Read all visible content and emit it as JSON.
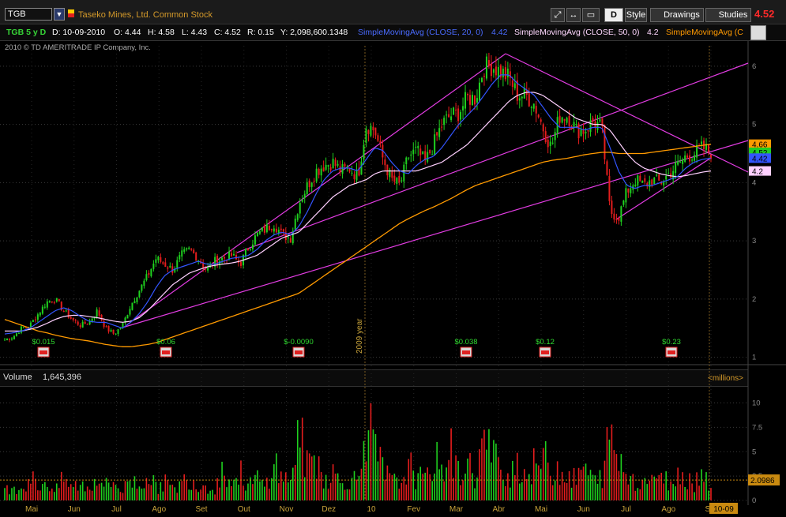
{
  "toolbar": {
    "symbol": "TGB",
    "company": "Taseko Mines, Ltd. Common Stock",
    "period_button": "D",
    "style_label": "Style",
    "drawings_label": "Drawings",
    "studies_label": "Studies",
    "last_price": "4.52"
  },
  "infobar": {
    "chart_id": "TGB 5 y D",
    "date": "D: 10-09-2010",
    "open": "O: 4.44",
    "high": "H: 4.58",
    "low": "L: 4.43",
    "close": "C: 4.52",
    "range": "R: 0.15",
    "volume_total": "Y: 2,098,600.1348",
    "sma20_label": "SimpleMovingAvg (CLOSE, 20, 0)",
    "sma20_value": "4.42",
    "sma50_label": "SimpleMovingAvg (CLOSE, 50, 0)",
    "sma50_value": "4.2",
    "sma200_label": "SimpleMovingAvg (C"
  },
  "copyright": "2010 © TD AMERITRADE IP Company, Inc.",
  "volume_panel": {
    "label": "Volume",
    "value": "1,645,396",
    "units": "<millions>",
    "current_level": "2.0986"
  },
  "chart_data": {
    "type": "candlestick",
    "price_axis": {
      "ticks": [
        1,
        2,
        3,
        4,
        5,
        6
      ],
      "ylim": [
        0.9,
        6.35
      ]
    },
    "volume_axis": {
      "ticks": [
        0,
        2.5,
        5,
        7.5,
        10
      ],
      "ylim": [
        0,
        11.5
      ]
    },
    "months": [
      "Mai",
      "Jun",
      "Jul",
      "Ago",
      "Set",
      "Out",
      "Nov",
      "Dez",
      "10",
      "Fev",
      "Mar",
      "Abr",
      "Mai",
      "Jun",
      "Jul",
      "Ago",
      "Set"
    ],
    "year_marker": "2009 year",
    "date_marker": "10-09",
    "price_tags": [
      {
        "label": "4.66",
        "value": 4.66,
        "color": "#ff9a00"
      },
      {
        "label": "4.52",
        "value": 4.52,
        "color": "#22cc22"
      },
      {
        "label": "4.42",
        "value": 4.42,
        "color": "#3355ff"
      },
      {
        "label": "4.2",
        "value": 4.2,
        "color": "#ffd0ff"
      }
    ],
    "dividends": [
      "$0.015",
      "$0.06",
      "$-0.0090",
      "$0.038",
      "$0.12",
      "$0.23"
    ],
    "close_series": [
      1.3,
      1.35,
      1.5,
      1.55,
      1.75,
      1.95,
      2.0,
      1.8,
      1.65,
      1.55,
      1.6,
      1.8,
      1.5,
      1.4,
      1.55,
      1.9,
      2.15,
      2.4,
      2.7,
      2.6,
      2.5,
      2.75,
      2.85,
      2.7,
      2.5,
      2.65,
      2.7,
      2.75,
      2.6,
      2.9,
      3.1,
      3.2,
      3.3,
      3.1,
      3.05,
      3.65,
      3.95,
      4.2,
      4.3,
      4.35,
      4.2,
      4.25,
      4.1,
      5.0,
      4.9,
      4.4,
      4.05,
      3.95,
      4.45,
      4.55,
      4.35,
      4.65,
      5.0,
      5.15,
      5.2,
      5.45,
      5.45,
      6.0,
      6.0,
      5.9,
      5.8,
      5.5,
      5.5,
      5.35,
      4.95,
      4.6,
      5.15,
      5.15,
      4.9,
      4.9,
      5.05,
      4.95,
      3.5,
      3.4,
      3.85,
      4.05,
      3.95,
      4.05,
      4.0,
      4.15,
      4.3,
      4.45,
      4.5,
      4.6,
      4.52
    ],
    "sma20_series": [
      1.4,
      1.42,
      1.45,
      1.5,
      1.6,
      1.7,
      1.8,
      1.85,
      1.8,
      1.7,
      1.62,
      1.6,
      1.6,
      1.55,
      1.5,
      1.6,
      1.75,
      1.95,
      2.2,
      2.4,
      2.5,
      2.55,
      2.6,
      2.65,
      2.6,
      2.6,
      2.65,
      2.7,
      2.72,
      2.75,
      2.85,
      3.0,
      3.1,
      3.15,
      3.1,
      3.25,
      3.5,
      3.8,
      4.05,
      4.2,
      4.25,
      4.25,
      4.2,
      4.4,
      4.6,
      4.55,
      4.35,
      4.2,
      4.15,
      4.3,
      4.4,
      4.45,
      4.6,
      4.8,
      5.0,
      5.15,
      5.3,
      5.5,
      5.7,
      5.85,
      5.85,
      5.7,
      5.6,
      5.5,
      5.3,
      5.1,
      4.95,
      4.95,
      4.95,
      4.9,
      4.95,
      4.95,
      4.6,
      4.2,
      3.95,
      3.9,
      3.95,
      3.95,
      4.0,
      4.05,
      4.1,
      4.25,
      4.35,
      4.4,
      4.42
    ],
    "sma50_series": [
      1.45,
      1.45,
      1.45,
      1.48,
      1.52,
      1.58,
      1.65,
      1.7,
      1.72,
      1.72,
      1.7,
      1.68,
      1.65,
      1.62,
      1.6,
      1.62,
      1.68,
      1.8,
      1.95,
      2.1,
      2.25,
      2.35,
      2.45,
      2.5,
      2.55,
      2.58,
      2.6,
      2.62,
      2.65,
      2.7,
      2.75,
      2.85,
      2.95,
      3.05,
      3.1,
      3.15,
      3.3,
      3.45,
      3.6,
      3.75,
      3.85,
      3.95,
      4.0,
      4.05,
      4.15,
      4.2,
      4.2,
      4.2,
      4.2,
      4.2,
      4.25,
      4.3,
      4.35,
      4.45,
      4.55,
      4.65,
      4.8,
      4.95,
      5.1,
      5.25,
      5.4,
      5.5,
      5.55,
      5.55,
      5.5,
      5.4,
      5.3,
      5.2,
      5.1,
      5.05,
      5.0,
      5.0,
      4.9,
      4.7,
      4.5,
      4.35,
      4.25,
      4.2,
      4.15,
      4.12,
      4.1,
      4.12,
      4.15,
      4.18,
      4.2
    ],
    "sma200_series": [
      1.65,
      1.6,
      1.55,
      1.5,
      1.45,
      1.42,
      1.38,
      1.35,
      1.32,
      1.3,
      1.28,
      1.25,
      1.22,
      1.2,
      1.18,
      1.18,
      1.2,
      1.22,
      1.25,
      1.3,
      1.35,
      1.4,
      1.45,
      1.5,
      1.55,
      1.6,
      1.65,
      1.7,
      1.75,
      1.8,
      1.85,
      1.9,
      1.95,
      2.0,
      2.05,
      2.1,
      2.2,
      2.3,
      2.4,
      2.5,
      2.6,
      2.7,
      2.8,
      2.9,
      3.0,
      3.1,
      3.2,
      3.3,
      3.38,
      3.45,
      3.52,
      3.58,
      3.65,
      3.72,
      3.8,
      3.88,
      3.95,
      4.0,
      4.05,
      4.1,
      4.15,
      4.2,
      4.25,
      4.3,
      4.35,
      4.38,
      4.4,
      4.42,
      4.45,
      4.48,
      4.5,
      4.52,
      4.52,
      4.5,
      4.5,
      4.5,
      4.5,
      4.52,
      4.54,
      4.56,
      4.58,
      4.6,
      4.62,
      4.64,
      4.66
    ],
    "volume_series": [
      1.2,
      2.1,
      1.5,
      3.0,
      1.8,
      2.5,
      1.1,
      2.8,
      1.6,
      2.2,
      1.4,
      3.3,
      1.9,
      2.4,
      1.2,
      2.9,
      1.7,
      3.8,
      1.5,
      2.6,
      1.3,
      2.2,
      3.1,
      1.8,
      2.0,
      1.5,
      4.2,
      2.1,
      3.5,
      1.9,
      2.8,
      1.6,
      5.5,
      2.4,
      3.2,
      8.8,
      4.1,
      5.9,
      2.7,
      3.6,
      2.1,
      3.0,
      2.4,
      10.8,
      6.2,
      3.8,
      2.5,
      2.0,
      4.6,
      3.1,
      2.4,
      5.4,
      4.0,
      6.5,
      3.3,
      4.8,
      3.0,
      7.8,
      5.6,
      4.1,
      3.5,
      5.0,
      3.2,
      4.4,
      5.6,
      3.8,
      4.2,
      3.1,
      2.6,
      4.5,
      2.3,
      3.0,
      8.3,
      5.2,
      3.4,
      2.8,
      2.2,
      3.6,
      2.4,
      2.7,
      3.0,
      3.4,
      2.2,
      3.8,
      2.1
    ]
  }
}
